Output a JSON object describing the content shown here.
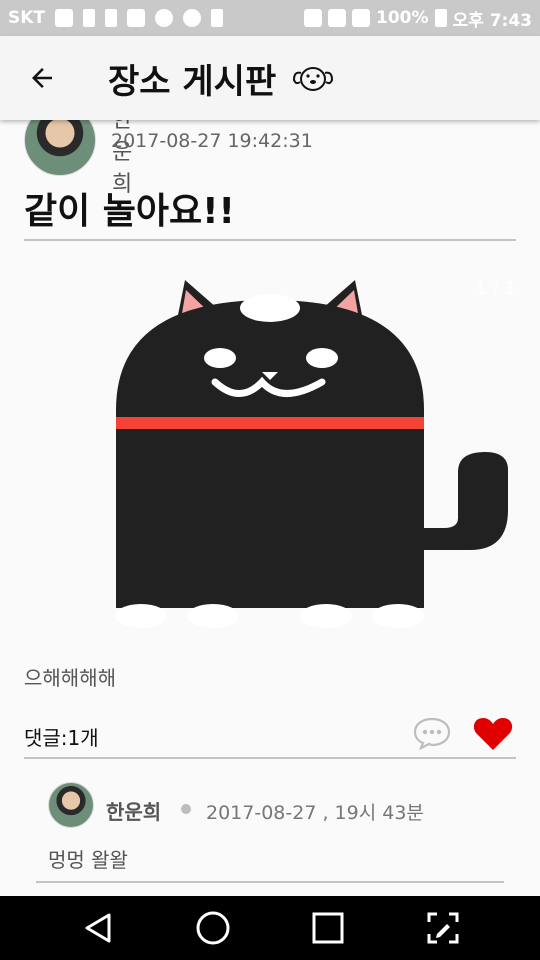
{
  "status_bar": {
    "carrier": "SKT",
    "battery": "100%",
    "time": "오후 7:43"
  },
  "app_bar": {
    "title": "장소 게시판"
  },
  "post": {
    "author": "한운희",
    "timestamp": "2017-08-27 19:42:31",
    "title": "같이 놀아요!!",
    "page_indicator": "1 / 1",
    "body": "으해해해해",
    "comment_count_label": "댓글:1개"
  },
  "comments": [
    {
      "author": "한운희",
      "timestamp": "2017-08-27 , 19시 43분",
      "text": "멍멍 왈왈"
    }
  ],
  "colors": {
    "accent_heart": "#e00000",
    "cat_body": "#212121",
    "cat_collar": "#f44336",
    "cat_ear_inner": "#f4a3a3"
  }
}
